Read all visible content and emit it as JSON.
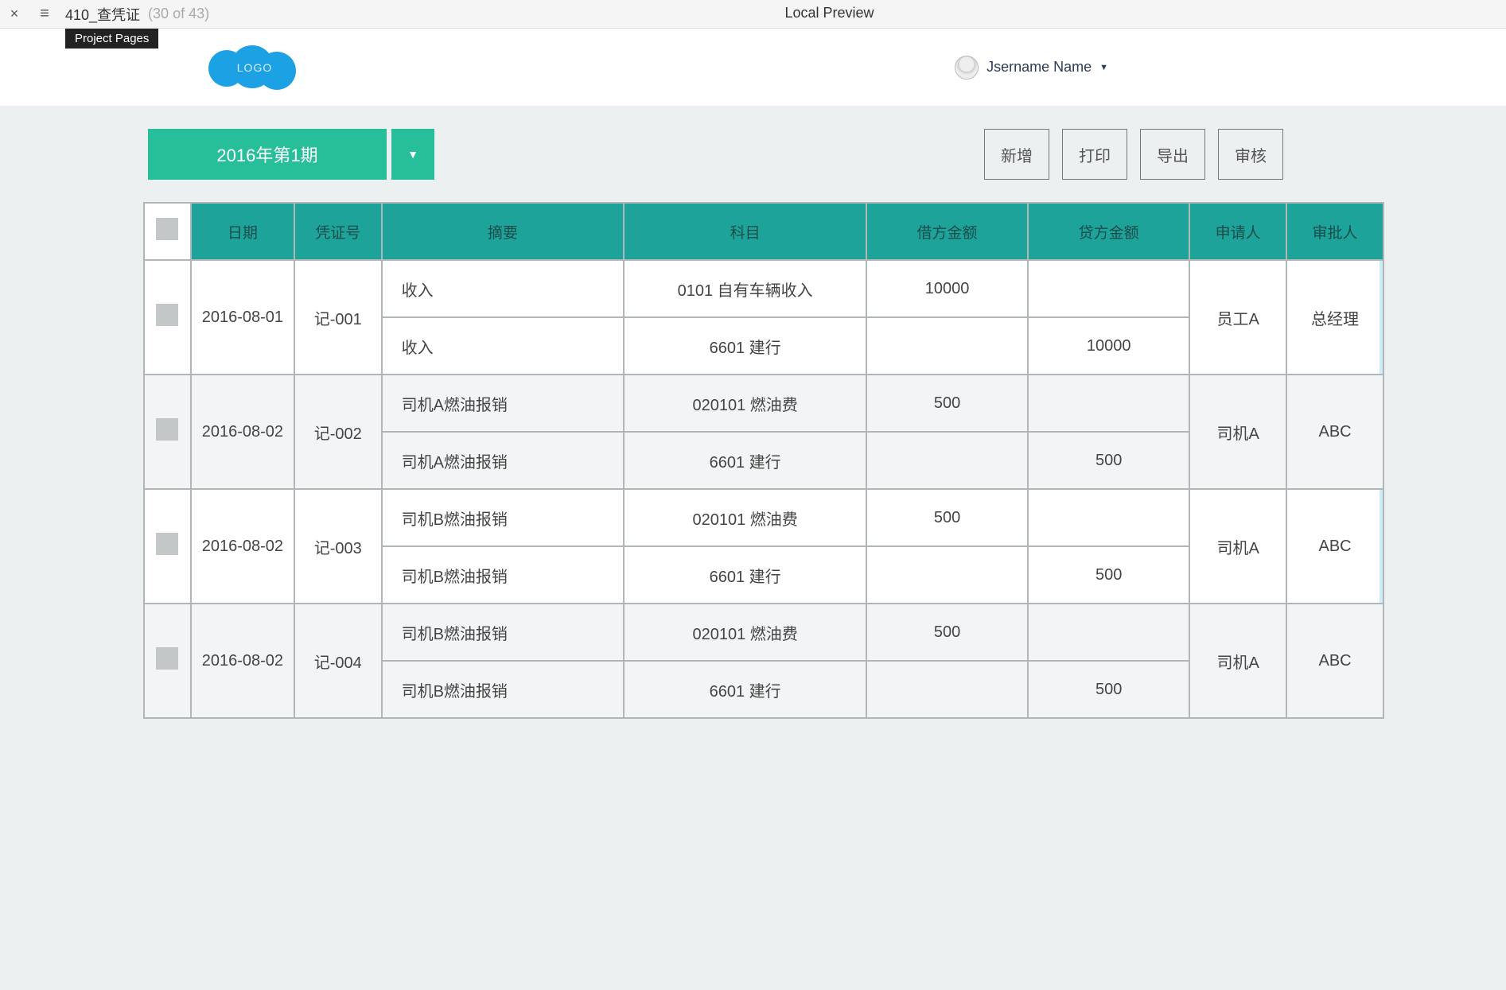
{
  "topbar": {
    "title": "410_查凭证",
    "counter": "(30 of 43)",
    "preview": "Local Preview",
    "tooltip": "Project Pages"
  },
  "header": {
    "logo": "LOGO",
    "username": "Jsername Name"
  },
  "toolbar": {
    "period": "2016年第1期",
    "buttons": {
      "add": "新增",
      "print": "打印",
      "export": "导出",
      "audit": "审核"
    }
  },
  "table": {
    "headers": {
      "date": "日期",
      "no": "凭证号",
      "summary": "摘要",
      "subject": "科目",
      "debit": "借方金额",
      "credit": "贷方金额",
      "applicant": "申请人",
      "approver": "审批人"
    },
    "rows": [
      {
        "date": "2016-08-01",
        "no": "记-001",
        "applicant": "员工A",
        "approver": "总经理",
        "stripe": false,
        "lines": [
          {
            "summary": "收入",
            "subject": "0101 自有车辆收入",
            "debit": "10000",
            "credit": ""
          },
          {
            "summary": "收入",
            "subject": "6601 建行",
            "debit": "",
            "credit": "10000"
          }
        ]
      },
      {
        "date": "2016-08-02",
        "no": "记-002",
        "applicant": "司机A",
        "approver": "ABC",
        "stripe": true,
        "lines": [
          {
            "summary": "司机A燃油报销",
            "subject": "020101 燃油费",
            "debit": "500",
            "credit": ""
          },
          {
            "summary": "司机A燃油报销",
            "subject": "6601 建行",
            "debit": "",
            "credit": "500"
          }
        ]
      },
      {
        "date": "2016-08-02",
        "no": "记-003",
        "applicant": "司机A",
        "approver": "ABC",
        "stripe": false,
        "lines": [
          {
            "summary": "司机B燃油报销",
            "subject": "020101 燃油费",
            "debit": "500",
            "credit": ""
          },
          {
            "summary": "司机B燃油报销",
            "subject": "6601 建行",
            "debit": "",
            "credit": "500"
          }
        ]
      },
      {
        "date": "2016-08-02",
        "no": "记-004",
        "applicant": "司机A",
        "approver": "ABC",
        "stripe": true,
        "lines": [
          {
            "summary": "司机B燃油报销",
            "subject": "020101 燃油费",
            "debit": "500",
            "credit": ""
          },
          {
            "summary": "司机B燃油报销",
            "subject": "6601 建行",
            "debit": "",
            "credit": "500"
          }
        ]
      }
    ]
  }
}
